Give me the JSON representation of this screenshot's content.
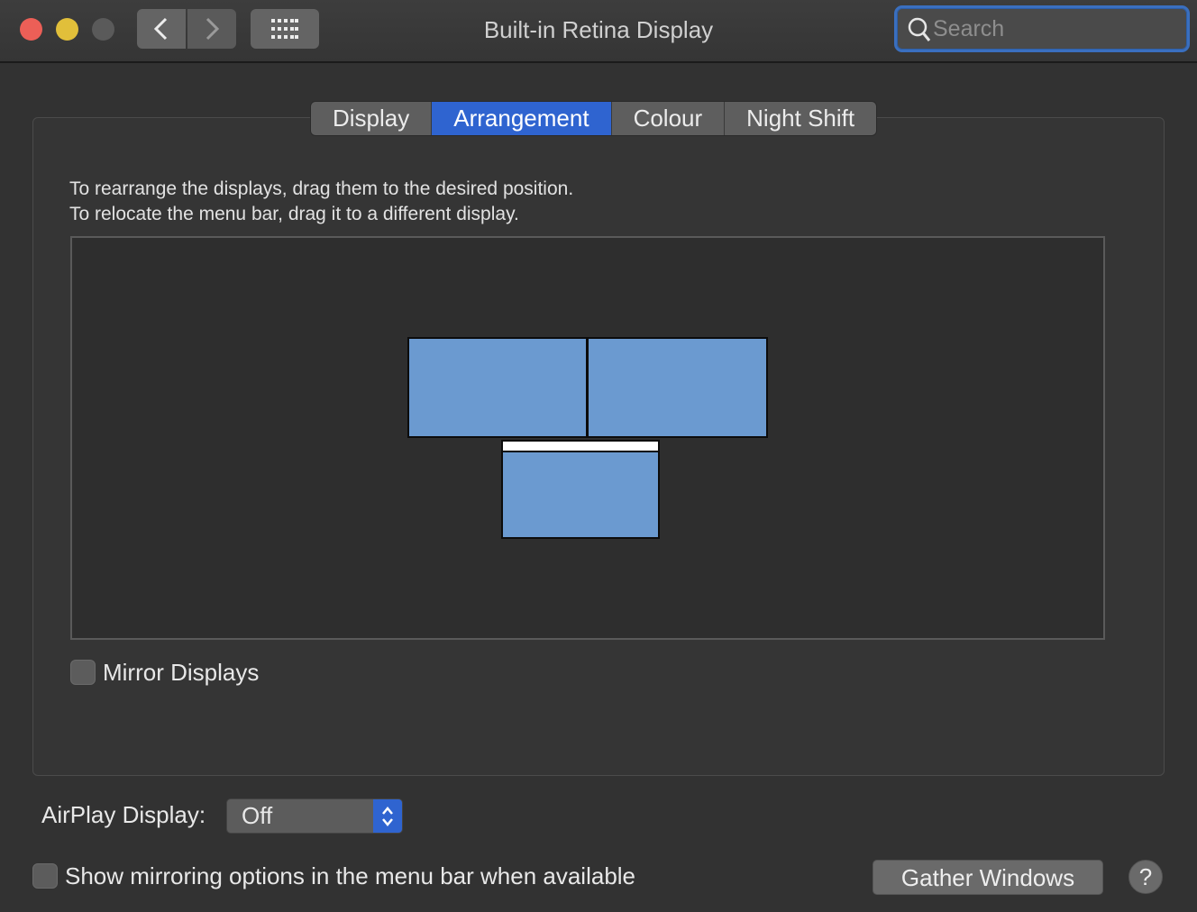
{
  "window": {
    "title": "Built-in Retina Display",
    "search_placeholder": "Search"
  },
  "tabs": [
    {
      "label": "Display",
      "selected": false
    },
    {
      "label": "Arrangement",
      "selected": true
    },
    {
      "label": "Colour",
      "selected": false
    },
    {
      "label": "Night Shift",
      "selected": false
    }
  ],
  "arrangement": {
    "instruction_line1": "To rearrange the displays, drag them to the desired position.",
    "instruction_line2": "To relocate the menu bar, drag it to a different display."
  },
  "mirror_displays": {
    "label": "Mirror Displays",
    "checked": false
  },
  "airplay": {
    "label": "AirPlay Display:",
    "value": "Off"
  },
  "show_mirroring": {
    "label": "Show mirroring options in the menu bar when available",
    "checked": false
  },
  "buttons": {
    "gather_windows": "Gather Windows",
    "help": "?"
  },
  "colors": {
    "accent": "#2f64d0",
    "display_fill": "#6b9ad0"
  }
}
